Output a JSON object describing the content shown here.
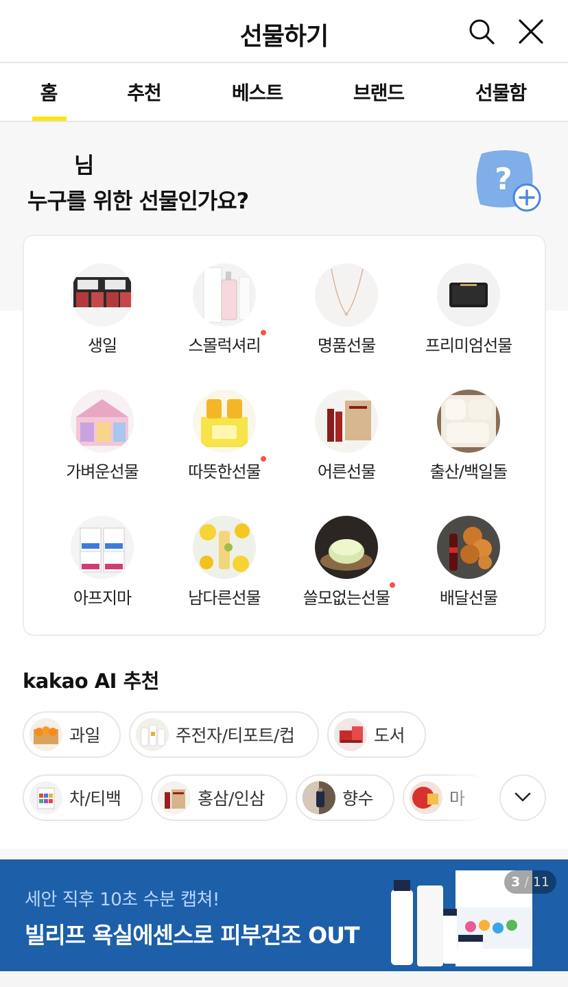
{
  "header": {
    "title": "선물하기",
    "search_icon": "search-icon",
    "close_icon": "close-icon"
  },
  "tabs": [
    {
      "label": "홈",
      "active": true
    },
    {
      "label": "추천",
      "active": false
    },
    {
      "label": "베스트",
      "active": false
    },
    {
      "label": "브랜드",
      "active": false
    },
    {
      "label": "선물함",
      "active": false
    }
  ],
  "hero": {
    "name_suffix": "님",
    "question": "누구를 위한 선물인가요?",
    "friend_icon": "question-add-friend-icon"
  },
  "categories": [
    {
      "label": "생일",
      "new": false
    },
    {
      "label": "스몰럭셔리",
      "new": true
    },
    {
      "label": "명품선물",
      "new": false
    },
    {
      "label": "프리미엄선물",
      "new": false
    },
    {
      "label": "가벼운선물",
      "new": false
    },
    {
      "label": "따뜻한선물",
      "new": true
    },
    {
      "label": "어른선물",
      "new": false
    },
    {
      "label": "출산/백일돌",
      "new": false
    },
    {
      "label": "아프지마",
      "new": false
    },
    {
      "label": "남다른선물",
      "new": false
    },
    {
      "label": "쓸모없는선물",
      "new": true
    },
    {
      "label": "배달선물",
      "new": false
    }
  ],
  "ai_section": {
    "brand": "kakao AI",
    "title": "추천",
    "chips_row1": [
      "과일",
      "주전자/티포트/컵",
      "도서"
    ],
    "chips_row2": [
      "차/티백",
      "홍삼/인삼",
      "향수",
      "마"
    ],
    "expand_icon": "chevron-down-icon"
  },
  "banner": {
    "subtitle": "세안 직후 10초 수분 캡쳐!",
    "title": "빌리프 욕실에센스로 피부건조 OUT",
    "page_current": "3",
    "page_separator": " / ",
    "page_total": "11"
  },
  "colors": {
    "accent_yellow": "#fee500",
    "new_dot": "#ff5046",
    "banner_bg": "#1d5fa8"
  }
}
